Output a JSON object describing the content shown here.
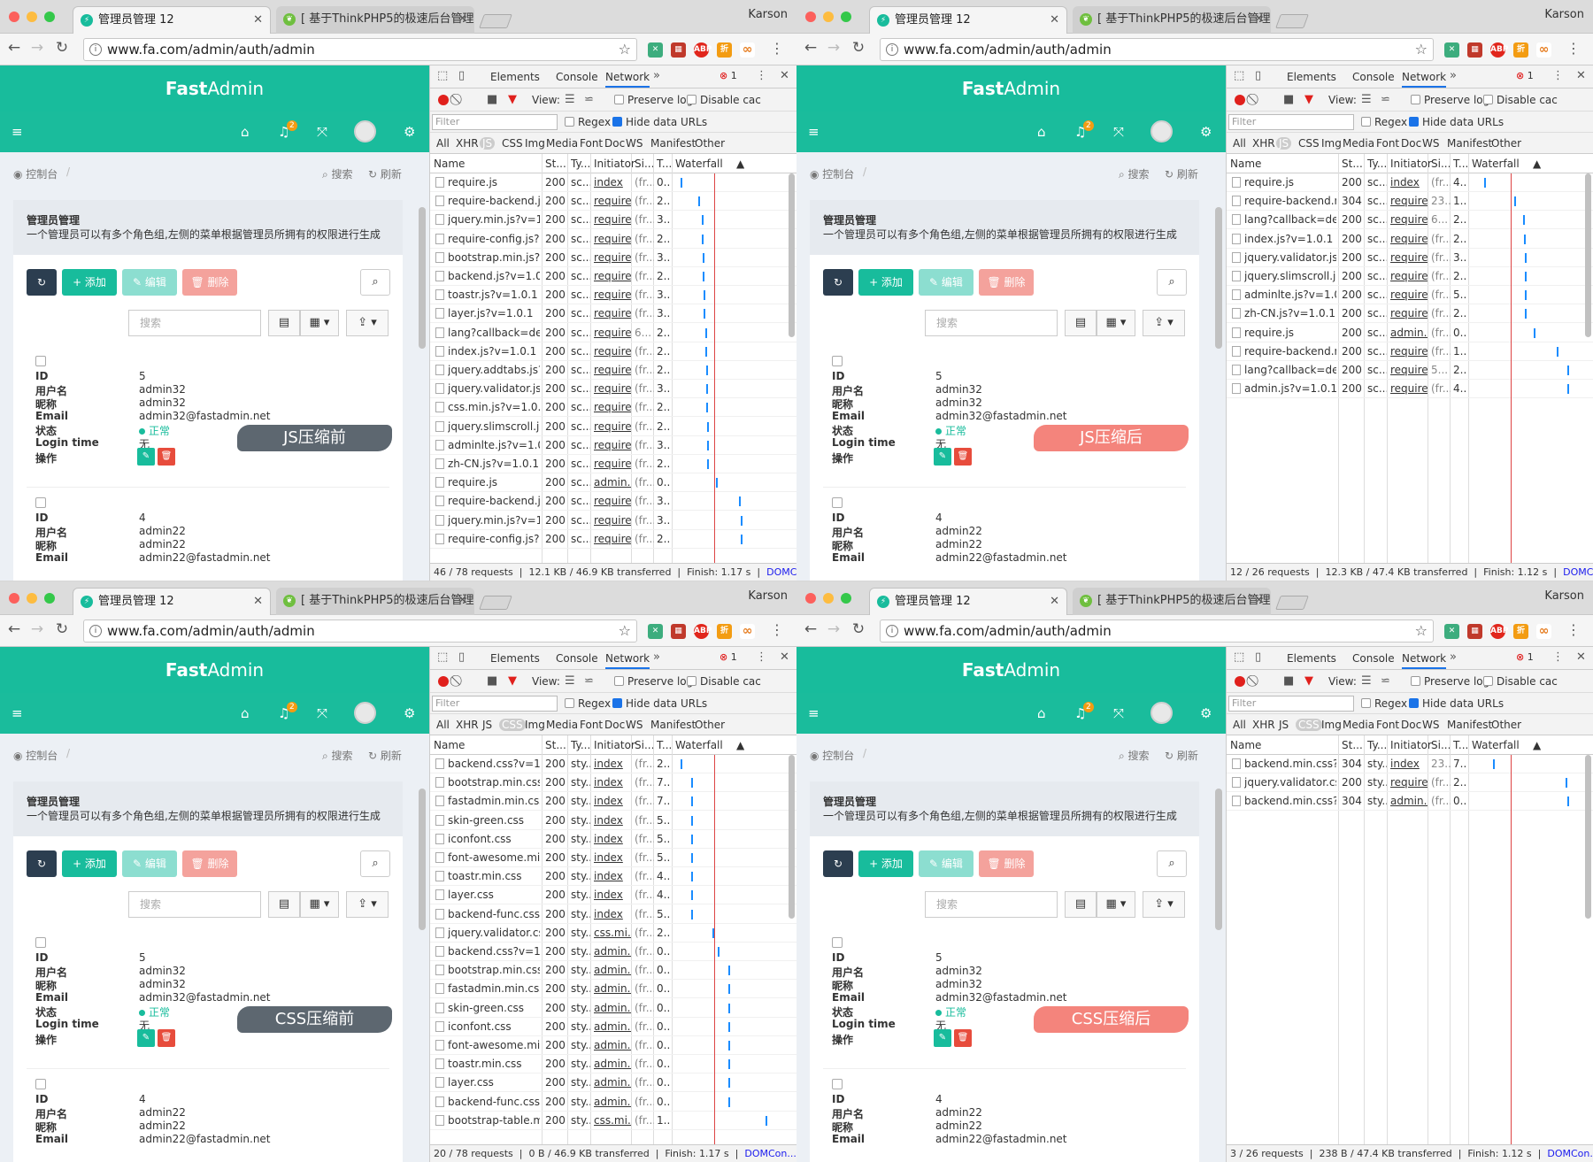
{
  "common": {
    "user": "Karson",
    "active_tab_title": "管理员管理 12",
    "inactive_tab_title": "[ 基于ThinkPHP5的极速后台管理",
    "url": "www.fa.com/admin/auth/admin",
    "logo_bold": "Fast",
    "logo_light": "Admin",
    "notification_count": "2",
    "breadcrumb_home": "控制台",
    "breadcrumb_search": "搜索",
    "breadcrumb_refresh": "刷新",
    "page_title": "管理员管理",
    "page_desc": "一个管理员可以有多个角色组,左侧的菜单根据管理员所拥有的权限进行生成",
    "add_label": "+ 添加",
    "edit_label": "编辑",
    "delete_label": "删除",
    "search_placeholder": "搜索",
    "card1": {
      "id_label": "ID",
      "id": "5",
      "username_label": "用户名",
      "username": "admin32",
      "nickname_label": "昵称",
      "nickname": "admin32",
      "email_label": "Email",
      "email": "admin32@fastadmin.net",
      "status_label": "状态",
      "status": "正常",
      "logintime_label": "Login time",
      "logintime": "无",
      "ops_label": "操作"
    },
    "card2": {
      "id_label": "ID",
      "id": "4",
      "username_label": "用户名",
      "username": "admin22",
      "nickname_label": "昵称",
      "nickname": "admin22",
      "email_label": "Email",
      "email": "admin22@fastadmin.net"
    },
    "devtools_tabs": [
      "Elements",
      "Console",
      "Network"
    ],
    "error_count": "1",
    "view_label": "View:",
    "preserve_log": "Preserve log",
    "disable_cache": "Disable cac",
    "filter_placeholder": "Filter",
    "regex_label": "Regex",
    "hide_data_urls": "Hide data URLs",
    "types": [
      "All",
      "XHR",
      "JS",
      "CSS",
      "Img",
      "Media",
      "Font",
      "Doc",
      "WS",
      "Manifest",
      "Other"
    ],
    "columns": [
      "Name",
      "St...",
      "Ty...",
      "Initiator",
      "Si...",
      "T...",
      "Waterfall"
    ],
    "dcl_label": "DOMCon..."
  },
  "colors": {
    "brand": "#18bc9c",
    "danger": "#e74c3c",
    "dark": "#2c3e50",
    "devtools_accent": "#1a73e8"
  },
  "panels": [
    {
      "type_selected": "JS",
      "label": "JS压缩前",
      "label_color": "#5d6770",
      "requests": [
        {
          "name": "require.js",
          "status": "200",
          "type": "sc...",
          "initiator": "index",
          "size": "(fr...",
          "time": "0...",
          "wf": 0.05
        },
        {
          "name": "require-backend.js?v...",
          "status": "200",
          "type": "sc...",
          "initiator": "require...",
          "size": "(fr...",
          "time": "2...",
          "wf": 0.22
        },
        {
          "name": "jquery.min.js?v=1.0.1",
          "status": "200",
          "type": "sc...",
          "initiator": "require...",
          "size": "(fr...",
          "time": "3...",
          "wf": 0.25
        },
        {
          "name": "require-config.js?v=1...",
          "status": "200",
          "type": "sc...",
          "initiator": "require...",
          "size": "(fr...",
          "time": "2...",
          "wf": 0.25
        },
        {
          "name": "bootstrap.min.js?v=1...",
          "status": "200",
          "type": "sc...",
          "initiator": "require...",
          "size": "(fr...",
          "time": "3...",
          "wf": 0.26
        },
        {
          "name": "backend.js?v=1.0.1",
          "status": "200",
          "type": "sc...",
          "initiator": "require...",
          "size": "(fr...",
          "time": "2...",
          "wf": 0.26
        },
        {
          "name": "toastr.js?v=1.0.1",
          "status": "200",
          "type": "sc...",
          "initiator": "require...",
          "size": "(fr...",
          "time": "3...",
          "wf": 0.27
        },
        {
          "name": "layer.js?v=1.0.1",
          "status": "200",
          "type": "sc...",
          "initiator": "require...",
          "size": "(fr...",
          "time": "3...",
          "wf": 0.27
        },
        {
          "name": "lang?callback=define...",
          "status": "200",
          "type": "sc...",
          "initiator": "require...",
          "size": "6...",
          "time": "2...",
          "wf": 0.28
        },
        {
          "name": "index.js?v=1.0.1",
          "status": "200",
          "type": "sc...",
          "initiator": "require...",
          "size": "(fr...",
          "time": "2...",
          "wf": 0.28
        },
        {
          "name": "jquery.addtabs.js?v=...",
          "status": "200",
          "type": "sc...",
          "initiator": "require...",
          "size": "(fr...",
          "time": "2...",
          "wf": 0.29
        },
        {
          "name": "jquery.validator.js?v=...",
          "status": "200",
          "type": "sc...",
          "initiator": "require...",
          "size": "(fr...",
          "time": "3...",
          "wf": 0.29
        },
        {
          "name": "css.min.js?v=1.0.1",
          "status": "200",
          "type": "sc...",
          "initiator": "require...",
          "size": "(fr...",
          "time": "2...",
          "wf": 0.29
        },
        {
          "name": "jquery.slimscroll.js?v...",
          "status": "200",
          "type": "sc...",
          "initiator": "require...",
          "size": "(fr...",
          "time": "2...",
          "wf": 0.3
        },
        {
          "name": "adminlte.js?v=1.0.1",
          "status": "200",
          "type": "sc...",
          "initiator": "require...",
          "size": "(fr...",
          "time": "3...",
          "wf": 0.3
        },
        {
          "name": "zh-CN.js?v=1.0.1",
          "status": "200",
          "type": "sc...",
          "initiator": "require...",
          "size": "(fr...",
          "time": "2...",
          "wf": 0.3
        },
        {
          "name": "require.js",
          "status": "200",
          "type": "sc...",
          "initiator": "admin...",
          "size": "(fr...",
          "time": "0...",
          "wf": 0.38
        },
        {
          "name": "require-backend.js?v...",
          "status": "200",
          "type": "sc...",
          "initiator": "require...",
          "size": "(fr...",
          "time": "3...",
          "wf": 0.6
        },
        {
          "name": "jquery.min.js?v=1.0.1",
          "status": "200",
          "type": "sc...",
          "initiator": "require...",
          "size": "(fr...",
          "time": "3...",
          "wf": 0.62
        },
        {
          "name": "require-config.js?v=...",
          "status": "200",
          "type": "sc...",
          "initiator": "require...",
          "size": "(fr...",
          "time": "2...",
          "wf": 0.62
        }
      ],
      "status": {
        "requests": "46 / 78 requests",
        "transferred": "12.1 KB / 46.9 KB transferred",
        "finish": "Finish: 1.17 s"
      }
    },
    {
      "type_selected": "JS",
      "label": "JS压缩后",
      "label_color": "#f4847c",
      "requests": [
        {
          "name": "require.js",
          "status": "200",
          "type": "sc...",
          "initiator": "index",
          "size": "(fr...",
          "time": "4...",
          "wf": 0.12
        },
        {
          "name": "require-backend.min...",
          "status": "304",
          "type": "sc...",
          "initiator": "require...",
          "size": "23...",
          "time": "1...",
          "wf": 0.4
        },
        {
          "name": "lang?callback=define...",
          "status": "200",
          "type": "sc...",
          "initiator": "require...",
          "size": "6...",
          "time": "2...",
          "wf": 0.48
        },
        {
          "name": "index.js?v=1.0.1",
          "status": "200",
          "type": "sc...",
          "initiator": "require...",
          "size": "(fr...",
          "time": "2...",
          "wf": 0.49
        },
        {
          "name": "jquery.validator.js?v=...",
          "status": "200",
          "type": "sc...",
          "initiator": "require...",
          "size": "(fr...",
          "time": "3...",
          "wf": 0.5
        },
        {
          "name": "jquery.slimscroll.js?v...",
          "status": "200",
          "type": "sc...",
          "initiator": "require...",
          "size": "(fr...",
          "time": "2...",
          "wf": 0.5
        },
        {
          "name": "adminlte.js?v=1.0.1",
          "status": "200",
          "type": "sc...",
          "initiator": "require...",
          "size": "(fr...",
          "time": "5...",
          "wf": 0.5
        },
        {
          "name": "zh-CN.js?v=1.0.1",
          "status": "200",
          "type": "sc...",
          "initiator": "require...",
          "size": "(fr...",
          "time": "2...",
          "wf": 0.5
        },
        {
          "name": "require.js",
          "status": "200",
          "type": "sc...",
          "initiator": "admin...",
          "size": "(fr...",
          "time": "0...",
          "wf": 0.58
        },
        {
          "name": "require-backend.min...",
          "status": "200",
          "type": "sc...",
          "initiator": "require...",
          "size": "(fr...",
          "time": "1...",
          "wf": 0.8
        },
        {
          "name": "lang?callback=define...",
          "status": "200",
          "type": "sc...",
          "initiator": "require...",
          "size": "5...",
          "time": "2...",
          "wf": 0.9
        },
        {
          "name": "admin.js?v=1.0.1",
          "status": "200",
          "type": "sc...",
          "initiator": "require...",
          "size": "(fr...",
          "time": "4...",
          "wf": 0.9
        }
      ],
      "status": {
        "requests": "12 / 26 requests",
        "transferred": "12.3 KB / 47.4 KB transferred",
        "finish": "Finish: 1.12 s"
      }
    },
    {
      "type_selected": "CSS",
      "label": "CSS压缩前",
      "label_color": "#5d6770",
      "requests": [
        {
          "name": "backend.css?v=1.0.1",
          "status": "200",
          "type": "sty...",
          "initiator": "index",
          "size": "(fr...",
          "time": "2...",
          "wf": 0.05
        },
        {
          "name": "bootstrap.min.css",
          "status": "200",
          "type": "sty...",
          "initiator": "index",
          "size": "(fr...",
          "time": "7...",
          "wf": 0.15
        },
        {
          "name": "fastadmin.min.css",
          "status": "200",
          "type": "sty...",
          "initiator": "index",
          "size": "(fr...",
          "time": "7...",
          "wf": 0.15
        },
        {
          "name": "skin-green.css",
          "status": "200",
          "type": "sty...",
          "initiator": "index",
          "size": "(fr...",
          "time": "5...",
          "wf": 0.15
        },
        {
          "name": "iconfont.css",
          "status": "200",
          "type": "sty...",
          "initiator": "index",
          "size": "(fr...",
          "time": "5...",
          "wf": 0.15
        },
        {
          "name": "font-awesome.min.c...",
          "status": "200",
          "type": "sty...",
          "initiator": "index",
          "size": "(fr...",
          "time": "5...",
          "wf": 0.15
        },
        {
          "name": "toastr.min.css",
          "status": "200",
          "type": "sty...",
          "initiator": "index",
          "size": "(fr...",
          "time": "4...",
          "wf": 0.15
        },
        {
          "name": "layer.css",
          "status": "200",
          "type": "sty...",
          "initiator": "index",
          "size": "(fr...",
          "time": "4...",
          "wf": 0.15
        },
        {
          "name": "backend-func.css",
          "status": "200",
          "type": "sty...",
          "initiator": "index",
          "size": "(fr...",
          "time": "5...",
          "wf": 0.15
        },
        {
          "name": "jquery.validator.css?v...",
          "status": "200",
          "type": "sty...",
          "initiator": "css.mi...",
          "size": "(fr...",
          "time": "2...",
          "wf": 0.35
        },
        {
          "name": "backend.css?v=1.0.1",
          "status": "200",
          "type": "sty...",
          "initiator": "admin...",
          "size": "(fr...",
          "time": "0...",
          "wf": 0.4
        },
        {
          "name": "bootstrap.min.css",
          "status": "200",
          "type": "sty...",
          "initiator": "admin...",
          "size": "(fr...",
          "time": "0...",
          "wf": 0.5
        },
        {
          "name": "fastadmin.min.css",
          "status": "200",
          "type": "sty...",
          "initiator": "admin...",
          "size": "(fr...",
          "time": "0...",
          "wf": 0.5
        },
        {
          "name": "skin-green.css",
          "status": "200",
          "type": "sty...",
          "initiator": "admin...",
          "size": "(fr...",
          "time": "0...",
          "wf": 0.5
        },
        {
          "name": "iconfont.css",
          "status": "200",
          "type": "sty...",
          "initiator": "admin...",
          "size": "(fr...",
          "time": "0...",
          "wf": 0.5
        },
        {
          "name": "font-awesome.min.c...",
          "status": "200",
          "type": "sty...",
          "initiator": "admin...",
          "size": "(fr...",
          "time": "0...",
          "wf": 0.5
        },
        {
          "name": "toastr.min.css",
          "status": "200",
          "type": "sty...",
          "initiator": "admin...",
          "size": "(fr...",
          "time": "0...",
          "wf": 0.5
        },
        {
          "name": "layer.css",
          "status": "200",
          "type": "sty...",
          "initiator": "admin...",
          "size": "(fr...",
          "time": "0...",
          "wf": 0.5
        },
        {
          "name": "backend-func.css",
          "status": "200",
          "type": "sty...",
          "initiator": "admin...",
          "size": "(fr...",
          "time": "0...",
          "wf": 0.5
        },
        {
          "name": "bootstrap-table.min....",
          "status": "200",
          "type": "sty...",
          "initiator": "css.mi...",
          "size": "(fr...",
          "time": "1...",
          "wf": 0.85
        }
      ],
      "status": {
        "requests": "20 / 78 requests",
        "transferred": "0 B / 46.9 KB transferred",
        "finish": "Finish: 1.17 s"
      }
    },
    {
      "type_selected": "CSS",
      "label": "CSS压缩后",
      "label_color": "#f4847c",
      "requests": [
        {
          "name": "backend.min.css?v=...",
          "status": "304",
          "type": "sty...",
          "initiator": "index",
          "size": "23...",
          "time": "7...",
          "wf": 0.2
        },
        {
          "name": "jquery.validator.css?v...",
          "status": "200",
          "type": "sty...",
          "initiator": "require...",
          "size": "(fr...",
          "time": "2...",
          "wf": 0.88
        },
        {
          "name": "backend.min.css?v=...",
          "status": "304",
          "type": "sty...",
          "initiator": "admin...",
          "size": "(fr...",
          "time": "0...",
          "wf": 0.9
        }
      ],
      "status": {
        "requests": "3 / 26 requests",
        "transferred": "238 B / 47.4 KB transferred",
        "finish": "Finish: 1.12 s"
      }
    }
  ]
}
